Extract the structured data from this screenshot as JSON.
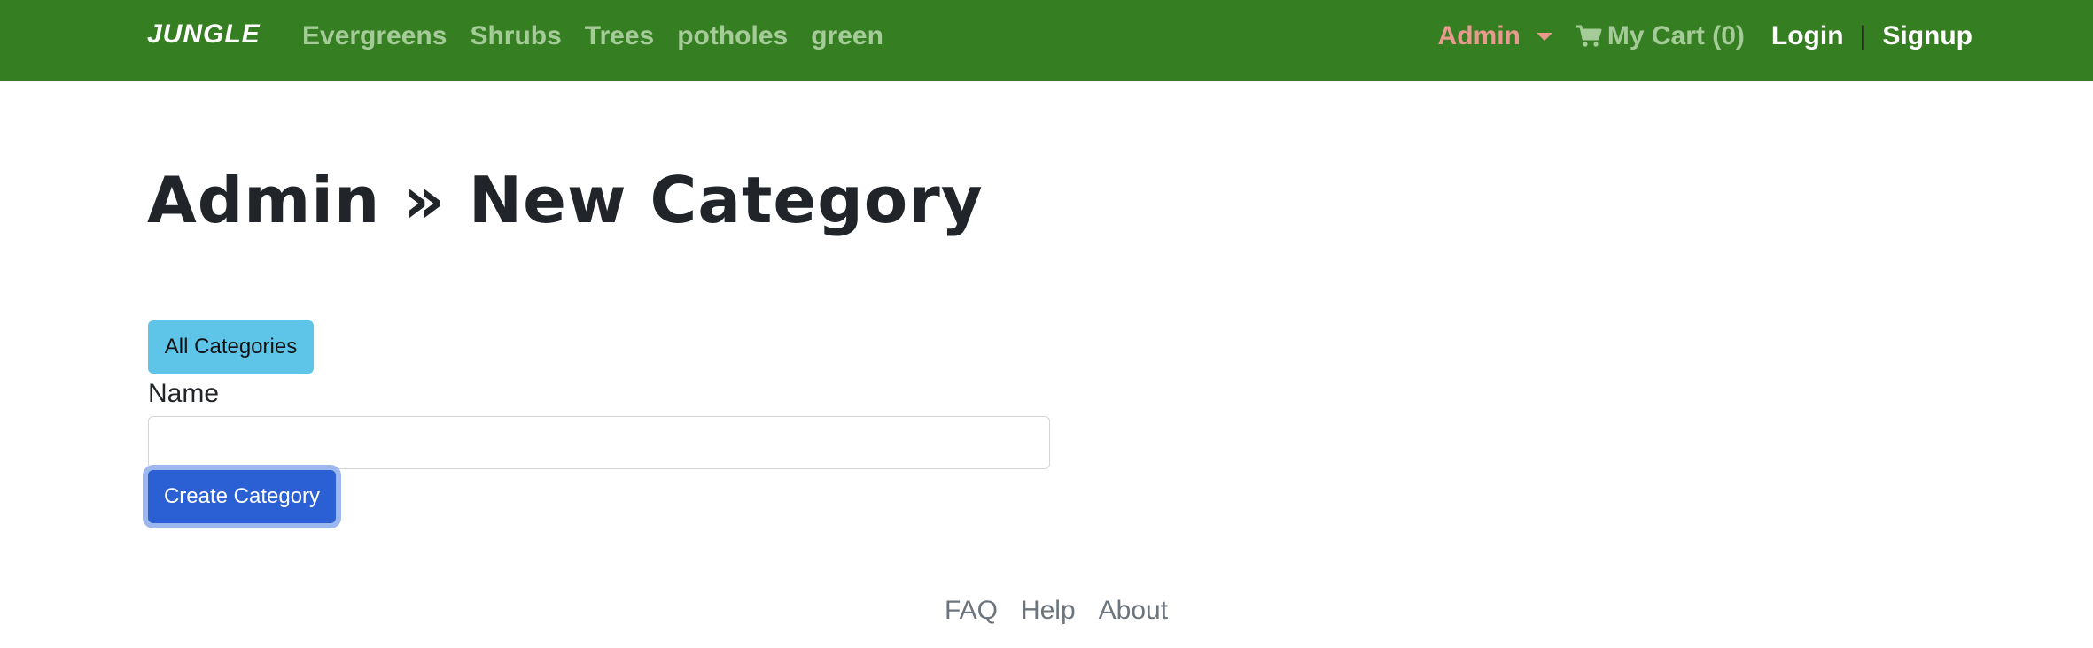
{
  "navbar": {
    "brand": "JUNGLE",
    "links": [
      "Evergreens",
      "Shrubs",
      "Trees",
      "potholes",
      "green"
    ],
    "admin_label": "Admin",
    "cart_label": "My Cart (0)",
    "cart_icon": "shopping-cart-icon",
    "login_label": "Login",
    "divider": "|",
    "signup_label": "Signup"
  },
  "main": {
    "title": "Admin » New Category",
    "all_categories_label": "All Categories",
    "name_label": "Name",
    "name_value": "",
    "create_label": "Create Category"
  },
  "footer": {
    "links": [
      "FAQ",
      "Help",
      "About"
    ]
  },
  "colors": {
    "navbar_bg": "#367e22",
    "nav_link": "#a5cc98",
    "admin": "#e89a8e",
    "info_button": "#5ec5e9",
    "primary_button": "#2b5fd4"
  }
}
